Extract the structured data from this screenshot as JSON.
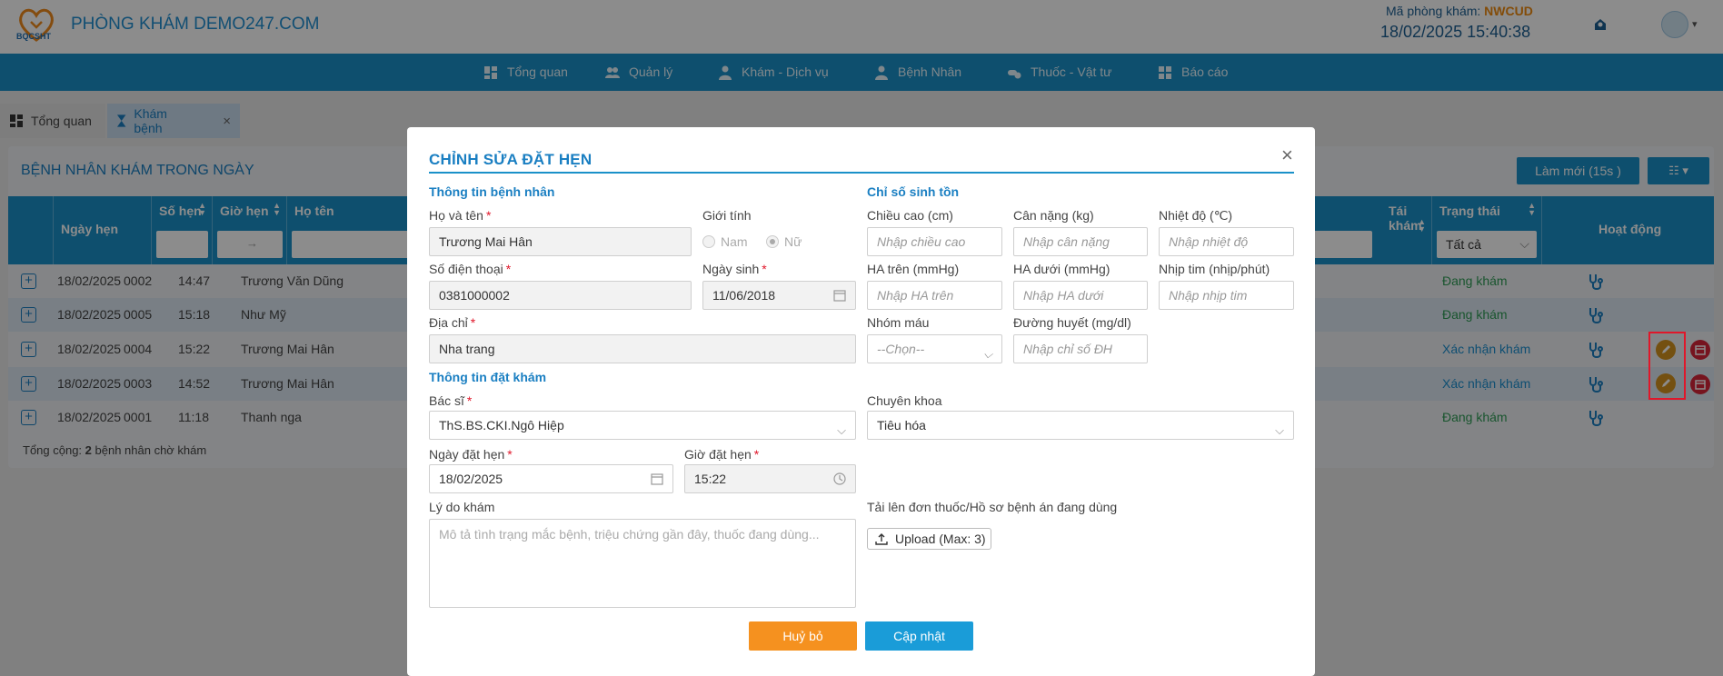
{
  "header": {
    "logo_text": "BQCSHT",
    "clinic_name": "PHÒNG KHÁM DEMO247.COM",
    "clinic_code_label": "Mã phòng khám: ",
    "clinic_code": "NWCUD",
    "datetime": "18/02/2025 15:40:38"
  },
  "nav": [
    {
      "label": "Tổng quan"
    },
    {
      "label": "Quản lý"
    },
    {
      "label": "Khám - Dịch vụ"
    },
    {
      "label": "Bệnh Nhân"
    },
    {
      "label": "Thuốc - Vật tư"
    },
    {
      "label": "Báo cáo"
    }
  ],
  "tabs": [
    {
      "label": "Tổng quan"
    },
    {
      "label": "Khám bệnh",
      "close": "×"
    }
  ],
  "panel": {
    "title": "BỆNH NHÂN KHÁM TRONG NGÀY",
    "refresh_label": "Làm mới (15s )",
    "columns_label": "☷ ▾",
    "headers": {
      "date": "Ngày hẹn",
      "number": "Số hẹn",
      "time": "Giờ hẹn",
      "name": "Họ tên",
      "revisit": "Tái khám",
      "status": "Trạng thái",
      "status_filter": "Tất cả",
      "actions": "Hoạt động",
      "time_filter_arrow": "→"
    },
    "rows": [
      {
        "date": "18/02/2025",
        "number": "0002",
        "time": "14:47",
        "name": "Trương Văn Dũng",
        "status": "Đang khám"
      },
      {
        "date": "18/02/2025",
        "number": "0005",
        "time": "15:18",
        "name": "Như Mỹ",
        "status": "Đang khám"
      },
      {
        "date": "18/02/2025",
        "number": "0004",
        "time": "15:22",
        "name": "Trương Mai Hân",
        "status": "Xác nhận khám"
      },
      {
        "date": "18/02/2025",
        "number": "0003",
        "time": "14:52",
        "name": "Trương Mai Hân",
        "status": "Xác nhận khám"
      },
      {
        "date": "18/02/2025",
        "number": "0001",
        "time": "11:18",
        "name": "Thanh nga",
        "status": "Đang khám"
      }
    ],
    "total_prefix": "Tổng cộng: ",
    "total_count": "2",
    "total_suffix": " bệnh nhân chờ khám"
  },
  "modal": {
    "title": "CHỈNH SỬA ĐẶT HẸN",
    "close": "×",
    "patient_section": "Thông tin bệnh nhân",
    "vitals_section": "Chỉ số sinh tồn",
    "booking_section": "Thông tin đặt khám",
    "full_name_label": "Họ và tên",
    "full_name": "Trương Mai Hân",
    "gender_label": "Giới tính",
    "gender_male": "Nam",
    "gender_female": "Nữ",
    "phone_label": "Số điện thoại",
    "phone": "0381000002",
    "dob_label": "Ngày sinh",
    "dob": "11/06/2018",
    "address_label": "Địa chỉ",
    "address": "Nha trang",
    "required_mark": "*",
    "height_label": "Chiều cao (cm)",
    "height_ph": "Nhập chiều cao",
    "weight_label": "Cân nặng (kg)",
    "weight_ph": "Nhập cân nặng",
    "temp_label": "Nhiệt độ (℃)",
    "temp_ph": "Nhập nhiệt độ",
    "bp_high_label": "HA trên (mmHg)",
    "bp_high_ph": "Nhập HA trên",
    "bp_low_label": "HA dưới (mmHg)",
    "bp_low_ph": "Nhập HA dưới",
    "pulse_label": "Nhịp tim (nhịp/phút)",
    "pulse_ph": "Nhập nhịp tim",
    "blood_label": "Nhóm máu",
    "blood_value": "--Chọn--",
    "glucose_label": "Đường huyết (mg/dl)",
    "glucose_ph": "Nhập chỉ số ĐH",
    "doctor_label": "Bác sĩ",
    "doctor": "ThS.BS.CKI.Ngô Hiệp",
    "specialty_label": "Chuyên khoa",
    "specialty": "Tiêu hóa",
    "appt_date_label": "Ngày đặt hẹn",
    "appt_date": "18/02/2025",
    "appt_time_label": "Giờ đặt hẹn",
    "appt_time": "15:22",
    "reason_label": "Lý do khám",
    "reason_ph": "Mô tả tình trạng mắc bệnh, triệu chứng gần đây, thuốc đang dùng...",
    "upload_label": "Tải lên đơn thuốc/Hồ sơ bệnh án đang dùng",
    "upload_button": "Upload (Max: 3)",
    "cancel_button": "Huỷ bỏ",
    "save_button": "Cập nhật"
  }
}
